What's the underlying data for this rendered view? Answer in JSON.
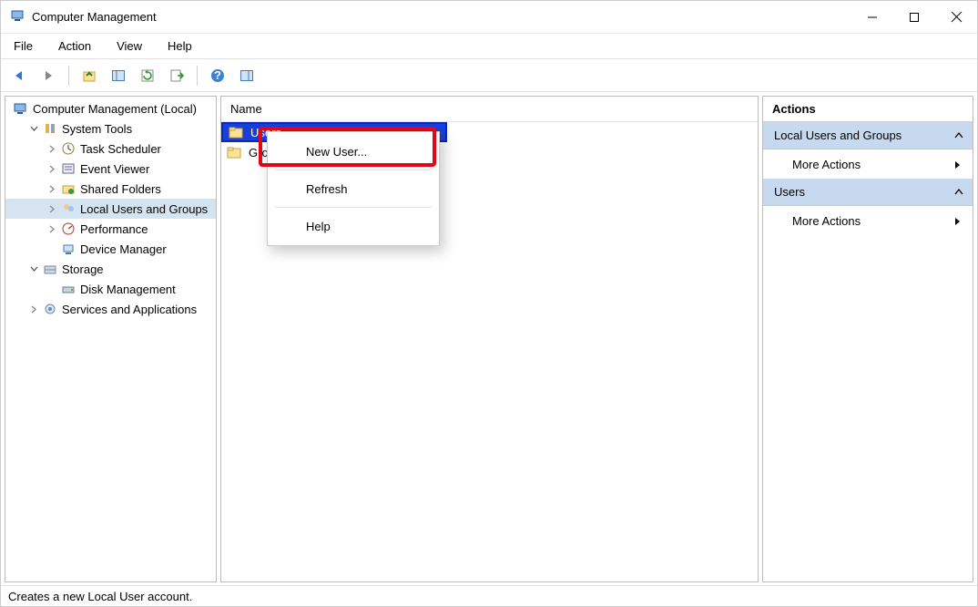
{
  "titlebar": {
    "title": "Computer Management"
  },
  "menu": {
    "file": "File",
    "action": "Action",
    "view": "View",
    "help": "Help"
  },
  "tree": {
    "root": "Computer Management (Local)",
    "systemTools": "System Tools",
    "taskScheduler": "Task Scheduler",
    "eventViewer": "Event Viewer",
    "sharedFolders": "Shared Folders",
    "localUsers": "Local Users and Groups",
    "performance": "Performance",
    "deviceManager": "Device Manager",
    "storage": "Storage",
    "diskManagement": "Disk Management",
    "servicesApps": "Services and Applications"
  },
  "list": {
    "columnName": "Name",
    "items": [
      {
        "label": "Users"
      },
      {
        "label": "Groups"
      }
    ]
  },
  "contextMenu": {
    "newUser": "New User...",
    "refresh": "Refresh",
    "help": "Help"
  },
  "actions": {
    "title": "Actions",
    "group1": "Local Users and Groups",
    "group2": "Users",
    "moreActions": "More Actions"
  },
  "statusbar": "Creates a new Local User account."
}
